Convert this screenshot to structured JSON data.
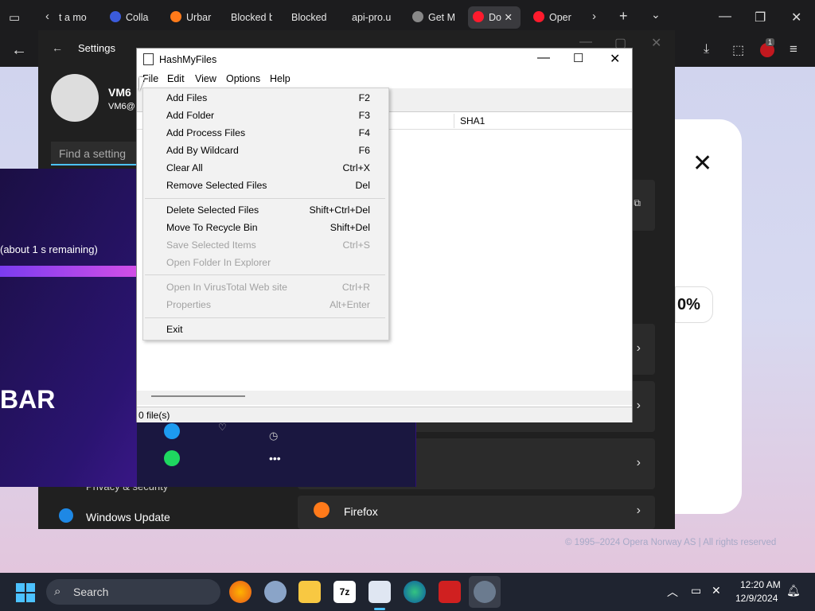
{
  "browser": {
    "tabs": [
      "t a mo",
      "Colla",
      "Urbar",
      "Blocked b",
      "Blocked",
      "api-pro.u",
      "Get M",
      "Do",
      "Oper"
    ],
    "accent": "#ff1b2d"
  },
  "settings": {
    "title": "Settings",
    "user_name": "VM6",
    "user_email": "VM6@",
    "search_placeholder": "Find a setting",
    "privacy_label": "Privacy & security",
    "update_label": "Windows Update",
    "firefox_label": "Firefox"
  },
  "download": {
    "status": "(about 1 s remaining)",
    "banner": "BAR"
  },
  "opera_page": {
    "percent": "0%",
    "footer": "© 1995–2024 Opera Norway AS | All rights reserved"
  },
  "hashmyfiles": {
    "title": "HashMyFiles",
    "menu": [
      "File",
      "Edit",
      "View",
      "Options",
      "Help"
    ],
    "column_sha1": "SHA1",
    "status": "0 file(s)"
  },
  "file_menu": {
    "group1": [
      {
        "label": "Add Files",
        "key": "F2"
      },
      {
        "label": "Add Folder",
        "key": "F3"
      },
      {
        "label": "Add Process Files",
        "key": "F4"
      },
      {
        "label": "Add By Wildcard",
        "key": "F6"
      },
      {
        "label": "Clear All",
        "key": "Ctrl+X"
      },
      {
        "label": "Remove Selected Files",
        "key": "Del"
      }
    ],
    "group2": [
      {
        "label": "Delete Selected Files",
        "key": "Shift+Ctrl+Del"
      },
      {
        "label": "Move To Recycle Bin",
        "key": "Shift+Del"
      },
      {
        "label": "Save Selected Items",
        "key": "Ctrl+S"
      },
      {
        "label": "Open Folder In Explorer",
        "key": ""
      }
    ],
    "group3": [
      {
        "label": "Open In VirusTotal Web site",
        "key": "Ctrl+R"
      },
      {
        "label": "Properties",
        "key": "Alt+Enter"
      }
    ],
    "exit": "Exit"
  },
  "taskbar": {
    "search": "Search",
    "time": "12:20 AM",
    "date": "12/9/2024",
    "badge": "1"
  }
}
